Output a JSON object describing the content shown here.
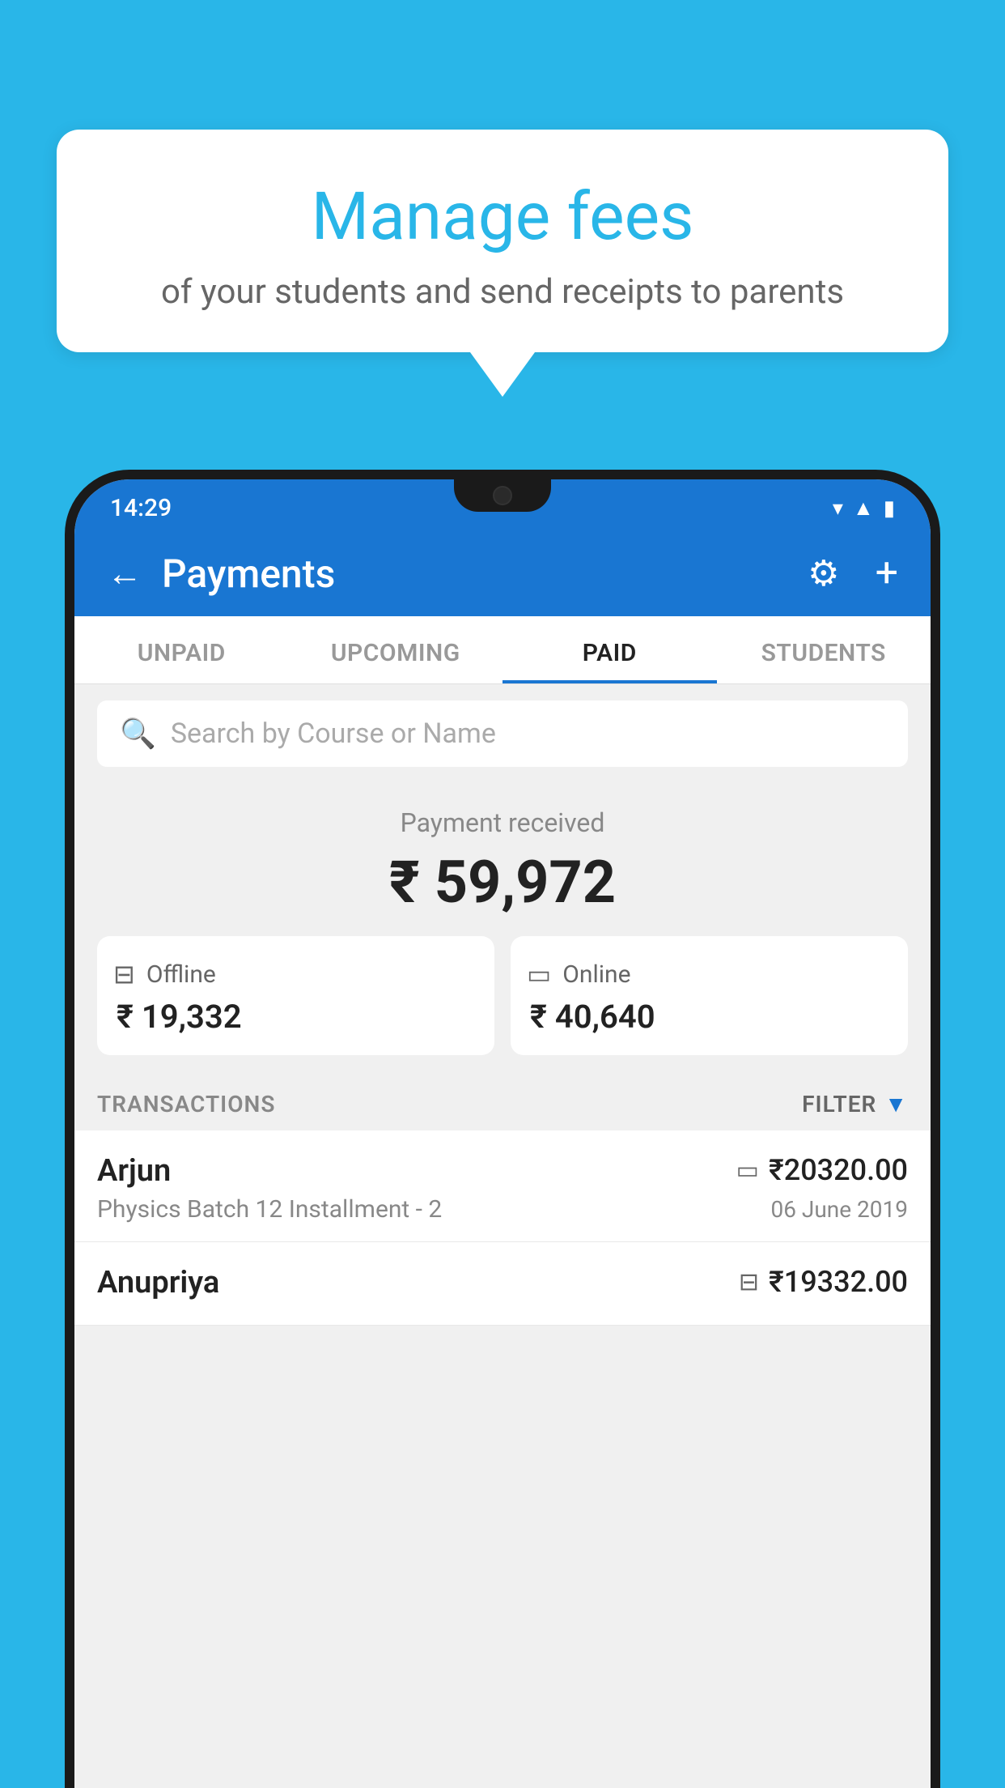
{
  "background_color": "#29b6e8",
  "speech_bubble": {
    "title": "Manage fees",
    "subtitle": "of your students and send receipts to parents"
  },
  "status_bar": {
    "time": "14:29",
    "icons": [
      "wifi",
      "signal",
      "battery"
    ]
  },
  "app_header": {
    "title": "Payments",
    "back_label": "←",
    "gear_label": "⚙",
    "plus_label": "+"
  },
  "tabs": [
    {
      "label": "UNPAID",
      "active": false
    },
    {
      "label": "UPCOMING",
      "active": false
    },
    {
      "label": "PAID",
      "active": true
    },
    {
      "label": "STUDENTS",
      "active": false
    }
  ],
  "search": {
    "placeholder": "Search by Course or Name"
  },
  "payment_summary": {
    "label": "Payment received",
    "total": "₹ 59,972",
    "offline": {
      "label": "Offline",
      "amount": "₹ 19,332"
    },
    "online": {
      "label": "Online",
      "amount": "₹ 40,640"
    }
  },
  "transactions_header": {
    "label": "TRANSACTIONS",
    "filter_label": "FILTER"
  },
  "transactions": [
    {
      "name": "Arjun",
      "amount": "₹20320.00",
      "course": "Physics Batch 12 Installment - 2",
      "date": "06 June 2019",
      "payment_type": "online"
    },
    {
      "name": "Anupriya",
      "amount": "₹19332.00",
      "course": "",
      "date": "",
      "payment_type": "offline"
    }
  ]
}
